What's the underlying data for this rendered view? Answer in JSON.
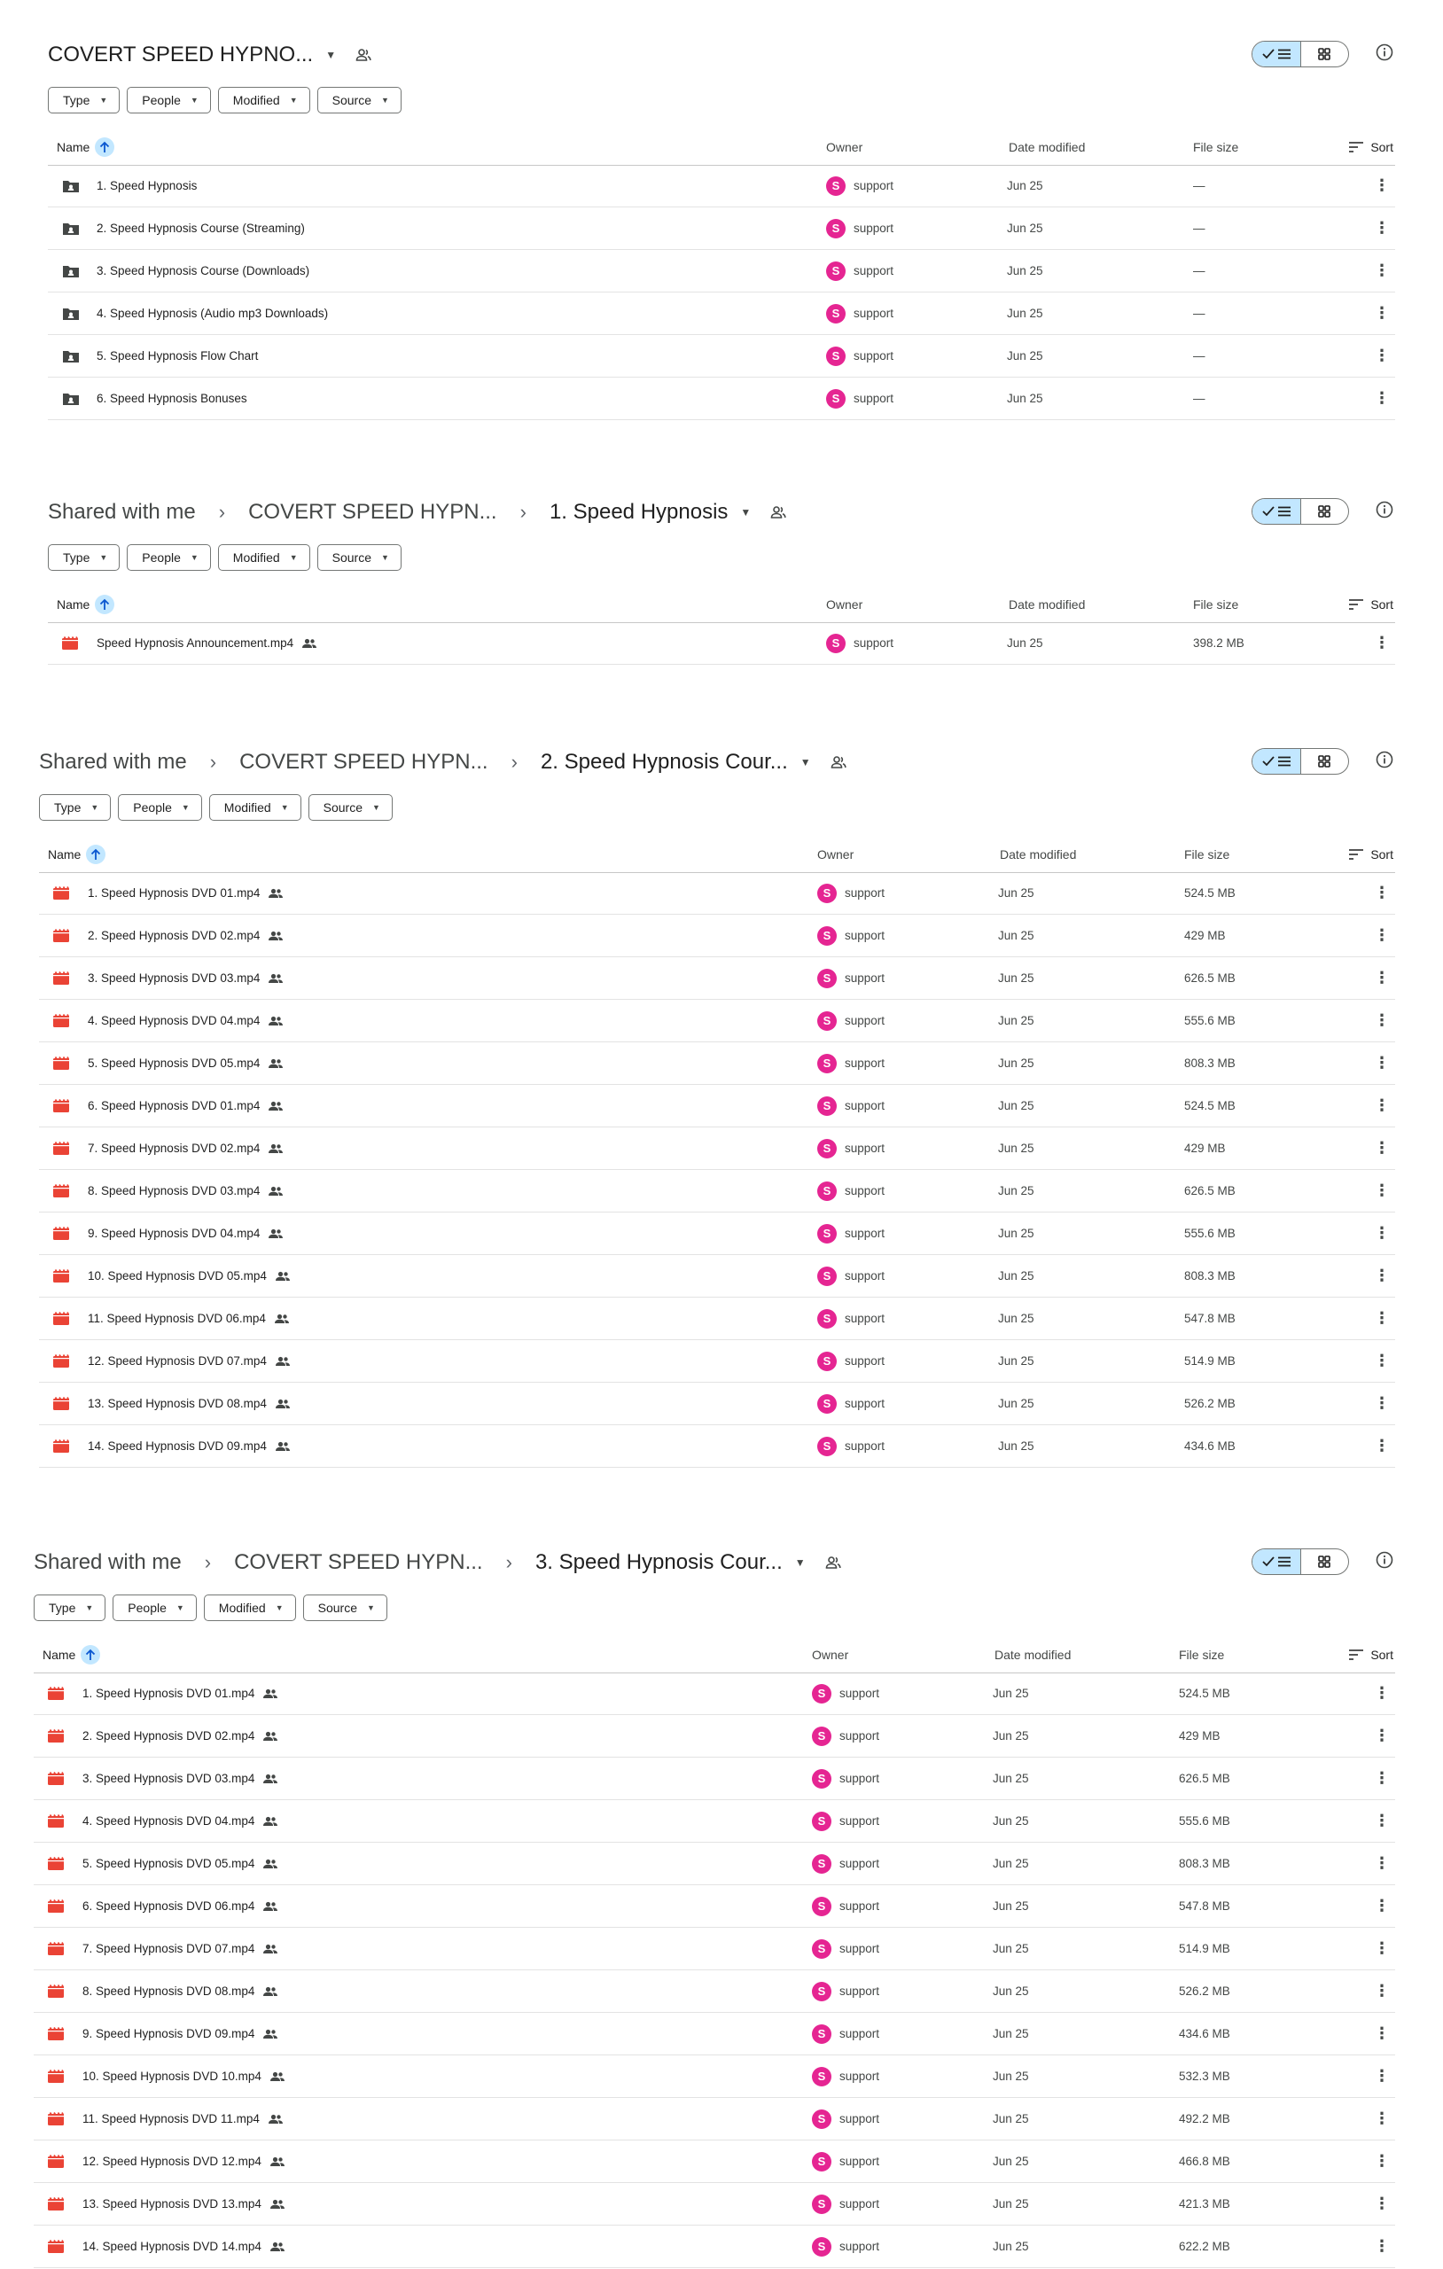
{
  "colors": {
    "accent": "#c2e7ff",
    "avatar": "#e52592",
    "video_icon": "#ea4335",
    "folder_icon": "#444746"
  },
  "panels": [
    {
      "breadcrumbs": [],
      "title": "COVERT SPEED HYPNO...",
      "filters": [
        "Type",
        "People",
        "Modified",
        "Source"
      ],
      "columns": {
        "name": "Name",
        "owner": "Owner",
        "date": "Date modified",
        "size": "File size",
        "sort": "Sort"
      },
      "rows": [
        {
          "icon": "shared-folder-icon",
          "name": "1. Speed Hypnosis",
          "shared": false,
          "owner": "support",
          "avatar": "S",
          "date": "Jun 25",
          "size": "—"
        },
        {
          "icon": "shared-folder-icon",
          "name": "2. Speed Hypnosis Course (Streaming)",
          "shared": false,
          "owner": "support",
          "avatar": "S",
          "date": "Jun 25",
          "size": "—"
        },
        {
          "icon": "shared-folder-icon",
          "name": "3. Speed Hypnosis Course (Downloads)",
          "shared": false,
          "owner": "support",
          "avatar": "S",
          "date": "Jun 25",
          "size": "—"
        },
        {
          "icon": "shared-folder-icon",
          "name": "4. Speed Hypnosis (Audio mp3 Downloads)",
          "shared": false,
          "owner": "support",
          "avatar": "S",
          "date": "Jun 25",
          "size": "—"
        },
        {
          "icon": "shared-folder-icon",
          "name": "5. Speed Hypnosis Flow Chart",
          "shared": false,
          "owner": "support",
          "avatar": "S",
          "date": "Jun 25",
          "size": "—"
        },
        {
          "icon": "shared-folder-icon",
          "name": "6. Speed Hypnosis Bonuses",
          "shared": false,
          "owner": "support",
          "avatar": "S",
          "date": "Jun 25",
          "size": "—"
        }
      ]
    },
    {
      "breadcrumbs": [
        "Shared with me",
        "COVERT SPEED HYPN..."
      ],
      "title": "1. Speed Hypnosis",
      "filters": [
        "Type",
        "People",
        "Modified",
        "Source"
      ],
      "columns": {
        "name": "Name",
        "owner": "Owner",
        "date": "Date modified",
        "size": "File size",
        "sort": "Sort"
      },
      "rows": [
        {
          "icon": "video-file-icon",
          "name": "Speed Hypnosis Announcement.mp4",
          "shared": true,
          "owner": "support",
          "avatar": "S",
          "date": "Jun 25",
          "size": "398.2 MB"
        }
      ]
    },
    {
      "breadcrumbs": [
        "Shared with me",
        "COVERT SPEED HYPN..."
      ],
      "title": "2. Speed Hypnosis Cour...",
      "filters": [
        "Type",
        "People",
        "Modified",
        "Source"
      ],
      "columns": {
        "name": "Name",
        "owner": "Owner",
        "date": "Date modified",
        "size": "File size",
        "sort": "Sort"
      },
      "rows": [
        {
          "icon": "video-file-icon",
          "name": "1. Speed Hypnosis DVD 01.mp4",
          "shared": true,
          "owner": "support",
          "avatar": "S",
          "date": "Jun 25",
          "size": "524.5 MB"
        },
        {
          "icon": "video-file-icon",
          "name": "2. Speed Hypnosis DVD 02.mp4",
          "shared": true,
          "owner": "support",
          "avatar": "S",
          "date": "Jun 25",
          "size": "429 MB"
        },
        {
          "icon": "video-file-icon",
          "name": "3. Speed Hypnosis DVD 03.mp4",
          "shared": true,
          "owner": "support",
          "avatar": "S",
          "date": "Jun 25",
          "size": "626.5 MB"
        },
        {
          "icon": "video-file-icon",
          "name": "4. Speed Hypnosis DVD 04.mp4",
          "shared": true,
          "owner": "support",
          "avatar": "S",
          "date": "Jun 25",
          "size": "555.6 MB"
        },
        {
          "icon": "video-file-icon",
          "name": "5. Speed Hypnosis DVD 05.mp4",
          "shared": true,
          "owner": "support",
          "avatar": "S",
          "date": "Jun 25",
          "size": "808.3 MB"
        },
        {
          "icon": "video-file-icon",
          "name": "6. Speed Hypnosis DVD 01.mp4",
          "shared": true,
          "owner": "support",
          "avatar": "S",
          "date": "Jun 25",
          "size": "524.5 MB"
        },
        {
          "icon": "video-file-icon",
          "name": "7. Speed Hypnosis DVD 02.mp4",
          "shared": true,
          "owner": "support",
          "avatar": "S",
          "date": "Jun 25",
          "size": "429 MB"
        },
        {
          "icon": "video-file-icon",
          "name": "8. Speed Hypnosis DVD 03.mp4",
          "shared": true,
          "owner": "support",
          "avatar": "S",
          "date": "Jun 25",
          "size": "626.5 MB"
        },
        {
          "icon": "video-file-icon",
          "name": "9. Speed Hypnosis DVD 04.mp4",
          "shared": true,
          "owner": "support",
          "avatar": "S",
          "date": "Jun 25",
          "size": "555.6 MB"
        },
        {
          "icon": "video-file-icon",
          "name": "10. Speed Hypnosis DVD 05.mp4",
          "shared": true,
          "owner": "support",
          "avatar": "S",
          "date": "Jun 25",
          "size": "808.3 MB"
        },
        {
          "icon": "video-file-icon",
          "name": "11. Speed Hypnosis DVD 06.mp4",
          "shared": true,
          "owner": "support",
          "avatar": "S",
          "date": "Jun 25",
          "size": "547.8 MB"
        },
        {
          "icon": "video-file-icon",
          "name": "12. Speed Hypnosis DVD 07.mp4",
          "shared": true,
          "owner": "support",
          "avatar": "S",
          "date": "Jun 25",
          "size": "514.9 MB"
        },
        {
          "icon": "video-file-icon",
          "name": "13. Speed Hypnosis DVD 08.mp4",
          "shared": true,
          "owner": "support",
          "avatar": "S",
          "date": "Jun 25",
          "size": "526.2 MB"
        },
        {
          "icon": "video-file-icon",
          "name": "14. Speed Hypnosis DVD 09.mp4",
          "shared": true,
          "owner": "support",
          "avatar": "S",
          "date": "Jun 25",
          "size": "434.6 MB"
        }
      ]
    },
    {
      "breadcrumbs": [
        "Shared with me",
        "COVERT SPEED HYPN..."
      ],
      "title": "3. Speed Hypnosis Cour...",
      "filters": [
        "Type",
        "People",
        "Modified",
        "Source"
      ],
      "columns": {
        "name": "Name",
        "owner": "Owner",
        "date": "Date modified",
        "size": "File size",
        "sort": "Sort"
      },
      "rows": [
        {
          "icon": "video-file-icon",
          "name": "1. Speed Hypnosis DVD 01.mp4",
          "shared": true,
          "owner": "support",
          "avatar": "S",
          "date": "Jun 25",
          "size": "524.5 MB"
        },
        {
          "icon": "video-file-icon",
          "name": "2. Speed Hypnosis DVD 02.mp4",
          "shared": true,
          "owner": "support",
          "avatar": "S",
          "date": "Jun 25",
          "size": "429 MB"
        },
        {
          "icon": "video-file-icon",
          "name": "3. Speed Hypnosis DVD 03.mp4",
          "shared": true,
          "owner": "support",
          "avatar": "S",
          "date": "Jun 25",
          "size": "626.5 MB"
        },
        {
          "icon": "video-file-icon",
          "name": "4. Speed Hypnosis DVD 04.mp4",
          "shared": true,
          "owner": "support",
          "avatar": "S",
          "date": "Jun 25",
          "size": "555.6 MB"
        },
        {
          "icon": "video-file-icon",
          "name": "5. Speed Hypnosis DVD 05.mp4",
          "shared": true,
          "owner": "support",
          "avatar": "S",
          "date": "Jun 25",
          "size": "808.3 MB"
        },
        {
          "icon": "video-file-icon",
          "name": "6. Speed Hypnosis DVD 06.mp4",
          "shared": true,
          "owner": "support",
          "avatar": "S",
          "date": "Jun 25",
          "size": "547.8 MB"
        },
        {
          "icon": "video-file-icon",
          "name": "7. Speed Hypnosis DVD 07.mp4",
          "shared": true,
          "owner": "support",
          "avatar": "S",
          "date": "Jun 25",
          "size": "514.9 MB"
        },
        {
          "icon": "video-file-icon",
          "name": "8. Speed Hypnosis DVD 08.mp4",
          "shared": true,
          "owner": "support",
          "avatar": "S",
          "date": "Jun 25",
          "size": "526.2 MB"
        },
        {
          "icon": "video-file-icon",
          "name": "9. Speed Hypnosis DVD 09.mp4",
          "shared": true,
          "owner": "support",
          "avatar": "S",
          "date": "Jun 25",
          "size": "434.6 MB"
        },
        {
          "icon": "video-file-icon",
          "name": "10. Speed Hypnosis DVD 10.mp4",
          "shared": true,
          "owner": "support",
          "avatar": "S",
          "date": "Jun 25",
          "size": "532.3 MB"
        },
        {
          "icon": "video-file-icon",
          "name": "11. Speed Hypnosis DVD 11.mp4",
          "shared": true,
          "owner": "support",
          "avatar": "S",
          "date": "Jun 25",
          "size": "492.2 MB"
        },
        {
          "icon": "video-file-icon",
          "name": "12. Speed Hypnosis DVD 12.mp4",
          "shared": true,
          "owner": "support",
          "avatar": "S",
          "date": "Jun 25",
          "size": "466.8 MB"
        },
        {
          "icon": "video-file-icon",
          "name": "13. Speed Hypnosis DVD 13.mp4",
          "shared": true,
          "owner": "support",
          "avatar": "S",
          "date": "Jun 25",
          "size": "421.3 MB"
        },
        {
          "icon": "video-file-icon",
          "name": "14. Speed Hypnosis DVD 14.mp4",
          "shared": true,
          "owner": "support",
          "avatar": "S",
          "date": "Jun 25",
          "size": "622.2 MB"
        }
      ]
    }
  ]
}
